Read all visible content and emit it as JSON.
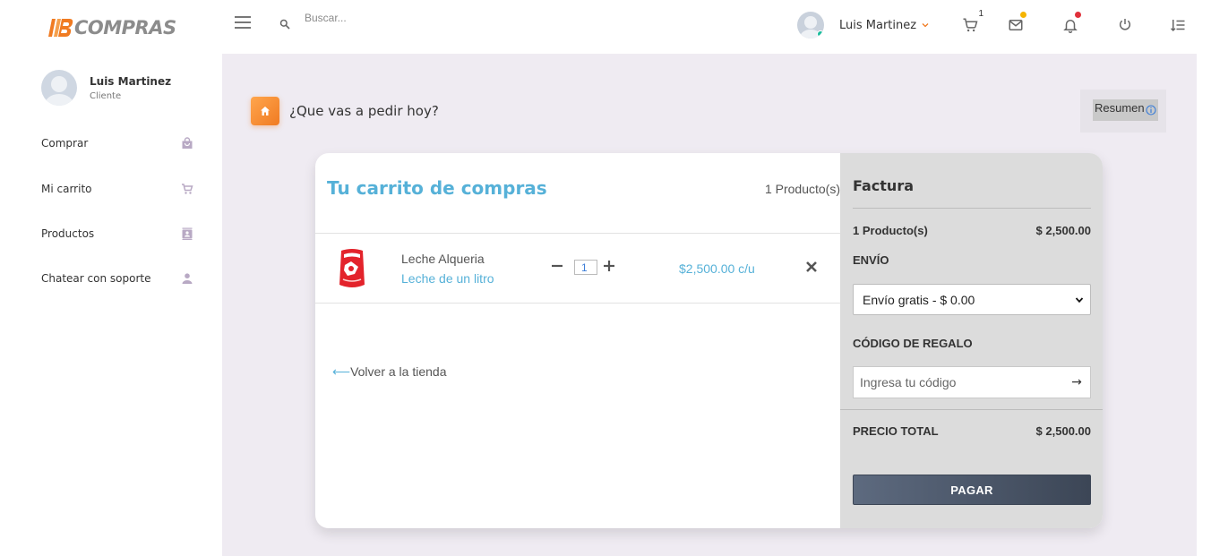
{
  "app": {
    "logo_text": "COMPRAS",
    "colors": {
      "accent_orange": "#f07b22",
      "accent_blue": "#56b1d8",
      "main_bg": "#efebf2",
      "factura_bg": "#dcdcdc",
      "pay_button": "#3c4656"
    }
  },
  "header": {
    "search_placeholder": "Buscar...",
    "user_name": "Luis Martinez",
    "cart_badge": "1",
    "icons": [
      "menu-icon",
      "search-icon",
      "cart-icon",
      "mail-icon",
      "bell-icon",
      "power-icon",
      "list-settings-icon"
    ]
  },
  "sidebar": {
    "profile": {
      "name": "Luis Martinez",
      "role": "Cliente"
    },
    "items": [
      {
        "label": "Comprar",
        "icon": "shopping-bag-icon"
      },
      {
        "label": "Mi carrito",
        "icon": "cart-icon"
      },
      {
        "label": "Productos",
        "icon": "contacts-icon"
      },
      {
        "label": "Chatear con soporte",
        "icon": "person-icon"
      }
    ]
  },
  "main": {
    "heading": "¿Que vas a pedir hoy?",
    "resumen_label": "Resumen"
  },
  "cart": {
    "title": "Tu carrito de compras",
    "count_label": "1 Producto(s)",
    "items": [
      {
        "name": "Leche Alqueria",
        "description": "Leche de un litro",
        "quantity": "1",
        "price": "$2,500.00 c/u"
      }
    ],
    "back_link": "Volver a la tienda",
    "back_arrow": "⟵"
  },
  "factura": {
    "title": "Factura",
    "products_label": "1 Producto(s)",
    "products_total": "$ 2,500.00",
    "shipping_label": "ENVÍO",
    "shipping_selected": "Envío gratis - $ 0.00",
    "gift_code_label": "CÓDIGO DE REGALO",
    "gift_code_placeholder": "Ingresa tu código",
    "gift_code_submit": "→",
    "total_label": "PRECIO TOTAL",
    "total_value": "$ 2,500.00",
    "pay_label": "PAGAR"
  }
}
